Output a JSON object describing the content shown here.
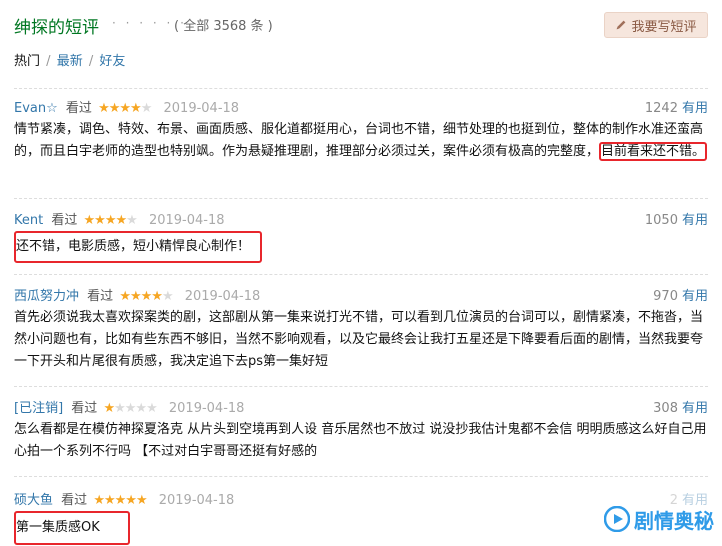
{
  "header": {
    "title": "绅探的短评",
    "dots": "· · · · · ·",
    "total": "( 全部 3568 条 )",
    "write_button": "我要写短评"
  },
  "tabs": {
    "hot": "热门",
    "latest": "最新",
    "friends": "好友",
    "sep": "/"
  },
  "comments": [
    {
      "user": "Evan☆",
      "status": "看过",
      "rating": 4,
      "date": "2019-04-18",
      "votes": "1242",
      "vote_label": "有用",
      "text_a": "情节紧凑，调色、特效、布景、画面质感、服化道都挺用心，台词也不错，细节处理的也挺到位，整体的制作水准还蛮高的，而且白宇老师的造型也特别飒。作为悬疑推理剧，推理部分必须过关，案件必须有极高的完整度，",
      "text_b": "目前看来还不错。"
    },
    {
      "user": "Kent",
      "status": "看过",
      "rating": 4,
      "date": "2019-04-18",
      "votes": "1050",
      "vote_label": "有用",
      "text": "还不错，电影质感，短小精悍良心制作！"
    },
    {
      "user": "西瓜努力冲",
      "status": "看过",
      "rating": 4,
      "date": "2019-04-18",
      "votes": "970",
      "vote_label": "有用",
      "text": "首先必须说我太喜欢探案类的剧，这部剧从第一集来说打光不错，可以看到几位演员的台词可以，剧情紧凑，不拖沓，当然小问题也有，比如有些东西不够旧，当然不影响观看，以及它最终会让我打五星还是下降要看后面的剧情，当然我要夸一下开头和片尾很有质感，我决定追下去ps第一集好短"
    },
    {
      "user": "[已注销]",
      "status": "看过",
      "rating": 1,
      "date": "2019-04-18",
      "votes": "308",
      "vote_label": "有用",
      "text": "怎么看都是在模仿神探夏洛克 从片头到空境再到人设 音乐居然也不放过 说没抄我估计鬼都不会信 明明质感这么好自己用心拍一个系列不行吗 【不过对白宇哥哥还挺有好感的"
    },
    {
      "user": "硕大鱼",
      "status": "看过",
      "rating": 5,
      "date": "2019-04-18",
      "votes": "2",
      "vote_label": "有用",
      "text": "第一集质感OK"
    }
  ],
  "watermark": "剧情奥秘",
  "colors": {
    "link": "#3377aa",
    "title_green": "#007722",
    "star": "#f6a623",
    "highlight_red": "#e8262c",
    "watermark_blue": "#2f9be8"
  }
}
